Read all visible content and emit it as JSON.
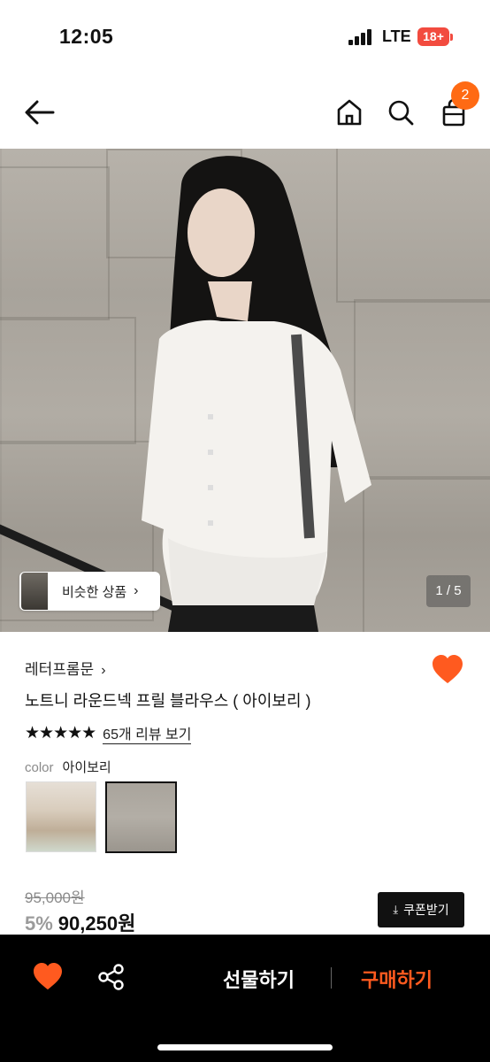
{
  "status_bar": {
    "time": "12:05",
    "network": "LTE",
    "battery": "18+"
  },
  "header": {
    "cart_count": "2"
  },
  "gallery": {
    "similar_label": "비슷한 상품",
    "pager": "1 / 5"
  },
  "product": {
    "brand": "레터프롬문",
    "title": "노트니 라운드넥 프릴 블라우스 ( 아이보리 )",
    "stars": "★★★★★",
    "review_link": "65개 리뷰 보기",
    "color_label": "color",
    "color_value": "아이보리",
    "original_price": "95,000원",
    "discount": "5%",
    "sale_price": "90,250원",
    "coupon_label": "쿠폰받기",
    "rating": 5
  },
  "bottom_bar": {
    "gift_label": "선물하기",
    "buy_label": "구매하기"
  },
  "colors": {
    "accent": "#ff6a13",
    "buy": "#ff5a1f",
    "heart": "#ff5a1f"
  },
  "icons": [
    "back-arrow-icon",
    "home-icon",
    "search-icon",
    "shopping-bag-icon",
    "heart-icon",
    "share-icon",
    "download-icon",
    "chevron-right-icon"
  ]
}
